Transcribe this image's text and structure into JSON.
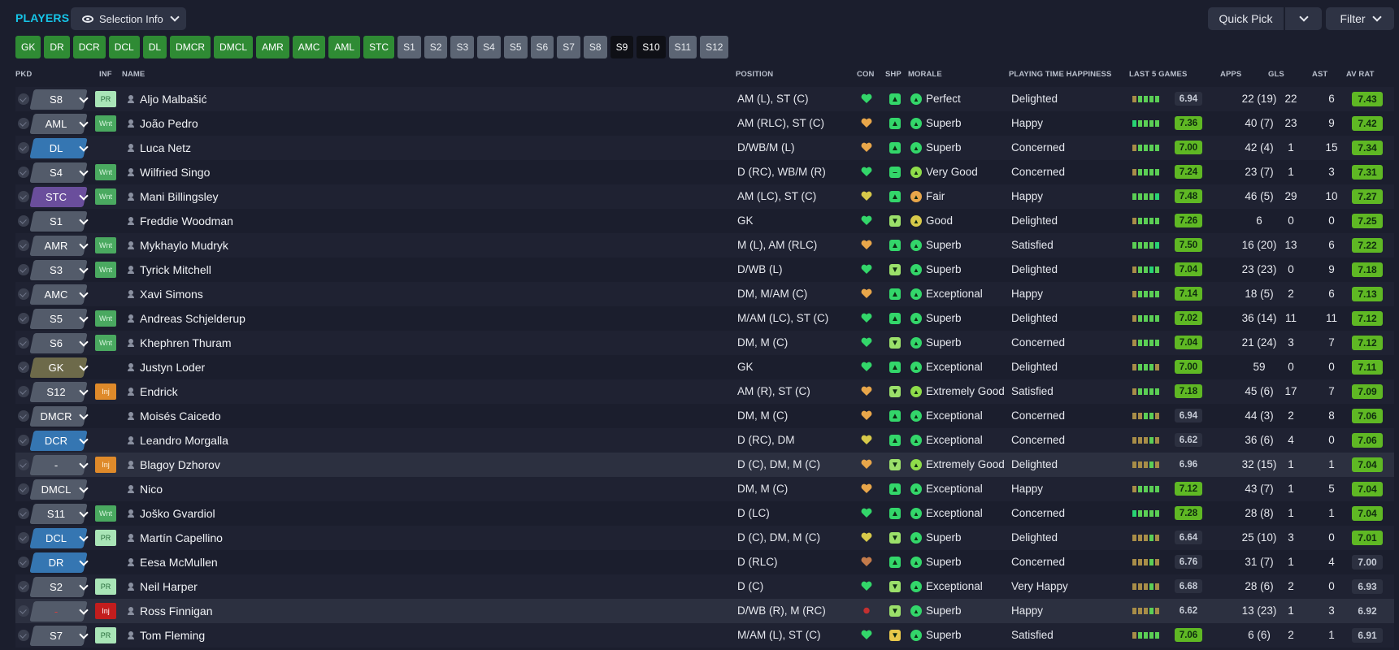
{
  "header": {
    "title": "PLAYERS",
    "selection_info": "Selection Info",
    "quick_pick": "Quick Pick",
    "filter": "Filter"
  },
  "position_chips": [
    "GK",
    "DR",
    "DCR",
    "DCL",
    "DL",
    "DMCR",
    "DMCL",
    "AMR",
    "AMC",
    "AML",
    "STC",
    "S1",
    "S2",
    "S3",
    "S4",
    "S5",
    "S6",
    "S7",
    "S8",
    "S9",
    "S10",
    "S11",
    "S12"
  ],
  "columns": {
    "pkd": "PKD",
    "inf": "INF",
    "name": "NAME",
    "position": "POSITION",
    "con": "CON",
    "shp": "SHP",
    "morale": "MORALE",
    "pth": "PLAYING TIME HAPPINESS",
    "last5": "LAST 5 GAMES",
    "apps": "APPS",
    "gls": "GLS",
    "ast": "AST",
    "avrat": "AV RAT"
  },
  "colors": {
    "accent": "#16c5e8",
    "positive_chip": "#2f8b34",
    "sub_chip": "#5c6574"
  },
  "players": [
    {
      "pkd": "S8",
      "inf": "PR",
      "name": "Aljo Malbašić",
      "position": "AM (L), ST (C)",
      "con": "green",
      "shp": "up",
      "morale": "Perfect",
      "pth": "Delighted",
      "form": [
        1,
        2,
        2,
        2,
        2
      ],
      "form_rating": "6.94",
      "apps": "22 (19)",
      "gls": "22",
      "ast": "6",
      "avrat": "7.43"
    },
    {
      "pkd": "AML",
      "inf": "Wnt",
      "name": "João Pedro",
      "position": "AM (RLC), ST (C)",
      "con": "amber",
      "shp": "up",
      "morale": "Superb",
      "pth": "Happy",
      "form": [
        3,
        2,
        2,
        2,
        2
      ],
      "form_rating": "7.36",
      "apps": "40 (7)",
      "gls": "23",
      "ast": "9",
      "avrat": "7.42"
    },
    {
      "pkd": "DL",
      "inf": "",
      "name": "Luca Netz",
      "position": "D/WB/M (L)",
      "con": "amber",
      "shp": "up",
      "morale": "Superb",
      "pth": "Concerned",
      "form": [
        1,
        2,
        2,
        2,
        2
      ],
      "form_rating": "7.00",
      "apps": "42 (4)",
      "gls": "1",
      "ast": "15",
      "avrat": "7.34"
    },
    {
      "pkd": "S4",
      "inf": "Wnt",
      "name": "Wilfried Singo",
      "position": "D (RC), WB/M (R)",
      "con": "green",
      "shp": "flat",
      "morale": "Very Good",
      "pth": "Concerned",
      "form": [
        1,
        2,
        2,
        2,
        2
      ],
      "form_rating": "7.24",
      "apps": "23 (7)",
      "gls": "1",
      "ast": "3",
      "avrat": "7.31"
    },
    {
      "pkd": "STC",
      "inf": "Wnt",
      "name": "Mani Billingsley",
      "position": "AM (LC), ST (C)",
      "con": "yellow",
      "shp": "up",
      "morale": "Fair",
      "pth": "Happy",
      "form": [
        2,
        2,
        2,
        2,
        3
      ],
      "form_rating": "7.48",
      "apps": "46 (5)",
      "gls": "29",
      "ast": "10",
      "avrat": "7.27"
    },
    {
      "pkd": "S1",
      "inf": "",
      "name": "Freddie Woodman",
      "position": "GK",
      "con": "green",
      "shp": "down",
      "morale": "Good",
      "pth": "Delighted",
      "form": [
        1,
        2,
        2,
        2,
        2
      ],
      "form_rating": "7.26",
      "apps": "6",
      "gls": "0",
      "ast": "0",
      "avrat": "7.25"
    },
    {
      "pkd": "AMR",
      "inf": "Wnt",
      "name": "Mykhaylo Mudryk",
      "position": "M (L), AM (RLC)",
      "con": "amber",
      "shp": "up",
      "morale": "Superb",
      "pth": "Satisfied",
      "form": [
        2,
        2,
        2,
        2,
        3
      ],
      "form_rating": "7.50",
      "apps": "16 (20)",
      "gls": "13",
      "ast": "6",
      "avrat": "7.22"
    },
    {
      "pkd": "S3",
      "inf": "Wnt",
      "name": "Tyrick Mitchell",
      "position": "D/WB (L)",
      "con": "green",
      "shp": "down",
      "morale": "Superb",
      "pth": "Delighted",
      "form": [
        1,
        2,
        2,
        3,
        2
      ],
      "form_rating": "7.04",
      "apps": "23 (23)",
      "gls": "0",
      "ast": "9",
      "avrat": "7.18"
    },
    {
      "pkd": "AMC",
      "inf": "",
      "name": "Xavi Simons",
      "position": "DM, M/AM (C)",
      "con": "amber",
      "shp": "up",
      "morale": "Exceptional",
      "pth": "Happy",
      "form": [
        1,
        2,
        2,
        2,
        2
      ],
      "form_rating": "7.14",
      "apps": "18 (5)",
      "gls": "2",
      "ast": "6",
      "avrat": "7.13"
    },
    {
      "pkd": "S5",
      "inf": "Wnt",
      "name": "Andreas Schjelderup",
      "position": "M/AM (LC), ST (C)",
      "con": "green",
      "shp": "up",
      "morale": "Superb",
      "pth": "Delighted",
      "form": [
        1,
        2,
        2,
        2,
        2
      ],
      "form_rating": "7.02",
      "apps": "36 (14)",
      "gls": "11",
      "ast": "11",
      "avrat": "7.12"
    },
    {
      "pkd": "S6",
      "inf": "Wnt",
      "name": "Khephren Thuram",
      "position": "DM, M (C)",
      "con": "green",
      "shp": "down",
      "morale": "Superb",
      "pth": "Concerned",
      "form": [
        1,
        2,
        2,
        2,
        2
      ],
      "form_rating": "7.04",
      "apps": "21 (24)",
      "gls": "3",
      "ast": "7",
      "avrat": "7.12"
    },
    {
      "pkd": "GK",
      "inf": "",
      "name": "Justyn Loder",
      "position": "GK",
      "con": "green",
      "shp": "up",
      "morale": "Exceptional",
      "pth": "Delighted",
      "form": [
        1,
        2,
        2,
        2,
        1
      ],
      "form_rating": "7.00",
      "apps": "59",
      "gls": "0",
      "ast": "0",
      "avrat": "7.11"
    },
    {
      "pkd": "S12",
      "inf": "Inj",
      "name": "Endrick",
      "position": "AM (R), ST (C)",
      "con": "amber",
      "shp": "down",
      "morale": "Extremely Good",
      "pth": "Satisfied",
      "form": [
        1,
        2,
        2,
        2,
        2
      ],
      "form_rating": "7.18",
      "apps": "45 (6)",
      "gls": "17",
      "ast": "7",
      "avrat": "7.09"
    },
    {
      "pkd": "DMCR",
      "inf": "",
      "name": "Moisés Caicedo",
      "position": "DM, M (C)",
      "con": "amber",
      "shp": "up",
      "morale": "Exceptional",
      "pth": "Concerned",
      "form": [
        1,
        1,
        2,
        2,
        1
      ],
      "form_rating": "6.94",
      "apps": "44 (3)",
      "gls": "2",
      "ast": "8",
      "avrat": "7.06"
    },
    {
      "pkd": "DCR",
      "inf": "",
      "name": "Leandro Morgalla",
      "position": "D (RC), DM",
      "con": "yellow",
      "shp": "up",
      "morale": "Exceptional",
      "pth": "Concerned",
      "form": [
        1,
        1,
        1,
        2,
        1
      ],
      "form_rating": "6.62",
      "apps": "36 (6)",
      "gls": "4",
      "ast": "0",
      "avrat": "7.06"
    },
    {
      "pkd": "-",
      "inf": "Inj",
      "name": "Blagoy Dzhorov",
      "position": "D (C), DM, M (C)",
      "con": "amber",
      "shp": "down",
      "morale": "Extremely Good",
      "pth": "Delighted",
      "form": [
        1,
        1,
        1,
        2,
        1
      ],
      "form_rating": "6.96",
      "apps": "32 (15)",
      "gls": "1",
      "ast": "1",
      "avrat": "7.04"
    },
    {
      "pkd": "DMCL",
      "inf": "",
      "name": "Nico",
      "position": "DM, M (C)",
      "con": "amber",
      "shp": "up",
      "morale": "Exceptional",
      "pth": "Happy",
      "form": [
        1,
        2,
        2,
        2,
        2
      ],
      "form_rating": "7.12",
      "apps": "43 (7)",
      "gls": "1",
      "ast": "5",
      "avrat": "7.04"
    },
    {
      "pkd": "S11",
      "inf": "Wnt",
      "name": "Joško Gvardiol",
      "position": "D (LC)",
      "con": "green",
      "shp": "up",
      "morale": "Exceptional",
      "pth": "Concerned",
      "form": [
        3,
        2,
        2,
        2,
        2
      ],
      "form_rating": "7.28",
      "apps": "28 (8)",
      "gls": "1",
      "ast": "1",
      "avrat": "7.04"
    },
    {
      "pkd": "DCL",
      "inf": "PR",
      "name": "Martín Capellino",
      "position": "D (C), DM, M (C)",
      "con": "yellow",
      "shp": "down",
      "morale": "Superb",
      "pth": "Delighted",
      "form": [
        1,
        1,
        1,
        2,
        1
      ],
      "form_rating": "6.64",
      "apps": "25 (10)",
      "gls": "3",
      "ast": "0",
      "avrat": "7.01"
    },
    {
      "pkd": "DR",
      "inf": "",
      "name": "Eesa McMullen",
      "position": "D (RLC)",
      "con": "brown",
      "shp": "up",
      "morale": "Superb",
      "pth": "Concerned",
      "form": [
        1,
        1,
        1,
        2,
        1
      ],
      "form_rating": "6.76",
      "apps": "31 (7)",
      "gls": "1",
      "ast": "4",
      "avrat": "7.00"
    },
    {
      "pkd": "S2",
      "inf": "PR",
      "name": "Neil Harper",
      "position": "D (C)",
      "con": "green",
      "shp": "down",
      "morale": "Exceptional",
      "pth": "Very Happy",
      "form": [
        1,
        1,
        1,
        2,
        1
      ],
      "form_rating": "6.68",
      "apps": "28 (6)",
      "gls": "2",
      "ast": "0",
      "avrat": "6.93"
    },
    {
      "pkd": "-",
      "inf": "InjR",
      "inf_label": "Inj",
      "name": "Ross Finnigan",
      "position": "D/WB (R), M (RC)",
      "con": "red",
      "shp": "down",
      "morale": "Superb",
      "pth": "Happy",
      "form": [
        1,
        1,
        1,
        2,
        1
      ],
      "form_rating": "6.62",
      "apps": "13 (23)",
      "gls": "1",
      "ast": "3",
      "avrat": "6.92"
    },
    {
      "pkd": "S7",
      "inf": "PR",
      "name": "Tom Fleming",
      "position": "M/AM (L), ST (C)",
      "con": "green",
      "shp": "downY",
      "morale": "Superb",
      "pth": "Satisfied",
      "form": [
        1,
        2,
        2,
        2,
        2
      ],
      "form_rating": "7.06",
      "apps": "6 (6)",
      "gls": "2",
      "ast": "1",
      "avrat": "6.91"
    }
  ]
}
